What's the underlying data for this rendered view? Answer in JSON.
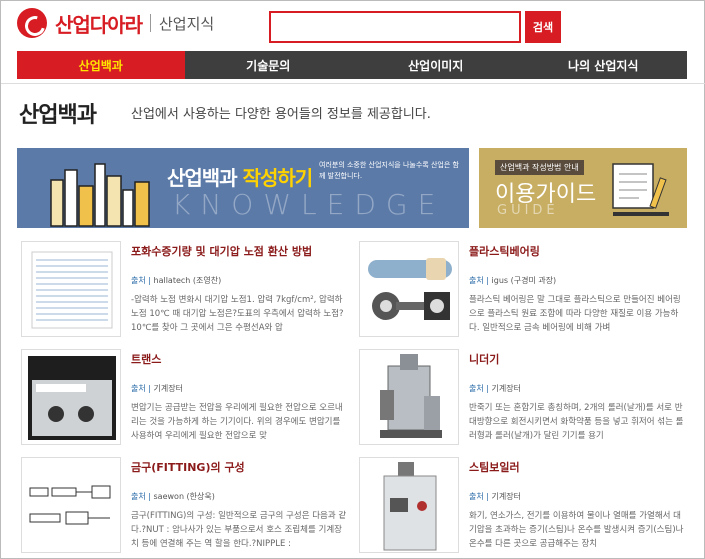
{
  "brand": {
    "name": "산업다아라",
    "sub": "산업지식"
  },
  "search": {
    "placeholder": "",
    "button": "검색"
  },
  "nav": [
    "산업백과",
    "기술문의",
    "산업이미지",
    "나의 산업지식"
  ],
  "page": {
    "title": "산업백과",
    "desc": "산업에서 사용하는 다양한 용어들의 정보를 제공합니다."
  },
  "banner_main": {
    "title_white": "산업백과 ",
    "title_yellow": "작성하기",
    "sub": "여러분의 소중한 산업지식을 나눌수록 산업은 함께 발전합니다.",
    "bg_word": "KNOWLEDGE"
  },
  "banner_guide": {
    "tag": "산업백과 작성방법 안내",
    "title": "이용가이드",
    "en": "GUIDE"
  },
  "source_label": "출처",
  "cards": [
    {
      "title": "포화수증기량 및 대기압 노점 환산 방법",
      "source": "hallatech (조영찬)",
      "body": "-압력하 노점 변화시 대기압 노점1. 압력 7kgf/cm², 압력하 노점 10℃ 때 대기압 노점은?도표의 우측에서 압력하 노점?10℃를 찾아 그 곳에서 그은 수평선A와 압"
    },
    {
      "title": "플라스틱베어링",
      "source": "igus (구경미 과장)",
      "body": "플라스틱 베어링은 말 그대로 플라스틱으로 만들어진 베어링으로 플라스틱 원료 조합에 따라 다양한 재질로 이용 가능하다. 일반적으로 금속 베어링에 비해 가벼"
    },
    {
      "title": "트랜스",
      "source": "기계장터",
      "body": "변압기는 공급받는 전압을 우리에게 필요한 전압으로 오르내리는 것을 가능하게 하는 기기이다. 위의 경우에도 변압기를 사용하여 우리에게 필요한 전압으로 맞"
    },
    {
      "title": "니더기",
      "source": "기계장터",
      "body": "반죽기 또는 혼합기로 총칭하며, 2개의 롤러(날개)를 서로 반대방향으로 회전시키면서 화학약품 등을 넣고 휘저어 섞는 롤러형과 롤러(날개)가 달린 기기를 용기"
    },
    {
      "title": "금구(FITTING)의 구성",
      "source": "saewon (한상욱)",
      "body": "금구(FITTING)의 구성: 일반적으로 금구의 구성은 다음과 같다.?NUT : 암나사가 있는 부품으로서 호스 조립체를 기계장치 등에 연결해 주는 역 할을 한다.?NIPPLE :"
    },
    {
      "title": "스팀보일러",
      "source": "기계장터",
      "body": "화기, 연소가스, 전기를 이용하여 물이나 열매를 가열해서 대기압을 초과하는 증기(스팀)나 온수를 발생시켜 증기(스팀)나 온수를 다른 곳으로 공급해주는 장치"
    }
  ],
  "colors": {
    "brand_red": "#d71d23",
    "nav_dark": "#3e3e3e",
    "nav_active_text": "#ffe400",
    "banner_blue": "#5b7aa8",
    "banner_gold": "#c8ae62"
  }
}
